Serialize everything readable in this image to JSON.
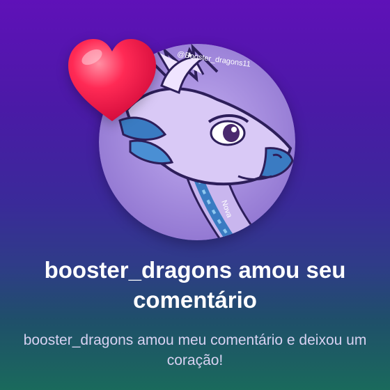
{
  "notification": {
    "title": "booster_dragons amou seu comentário",
    "message": "booster_dragons amou meu comentário e deixou um coração!"
  },
  "avatar": {
    "watermark": "@Booster_dragons11",
    "signature": "Nova"
  },
  "icons": {
    "heart": "heart-icon"
  },
  "colors": {
    "background_top": "#5f11b8",
    "background_bottom": "#1a6a5c",
    "heart": "#ff2a55",
    "avatar_circle": "#a98ee0"
  }
}
